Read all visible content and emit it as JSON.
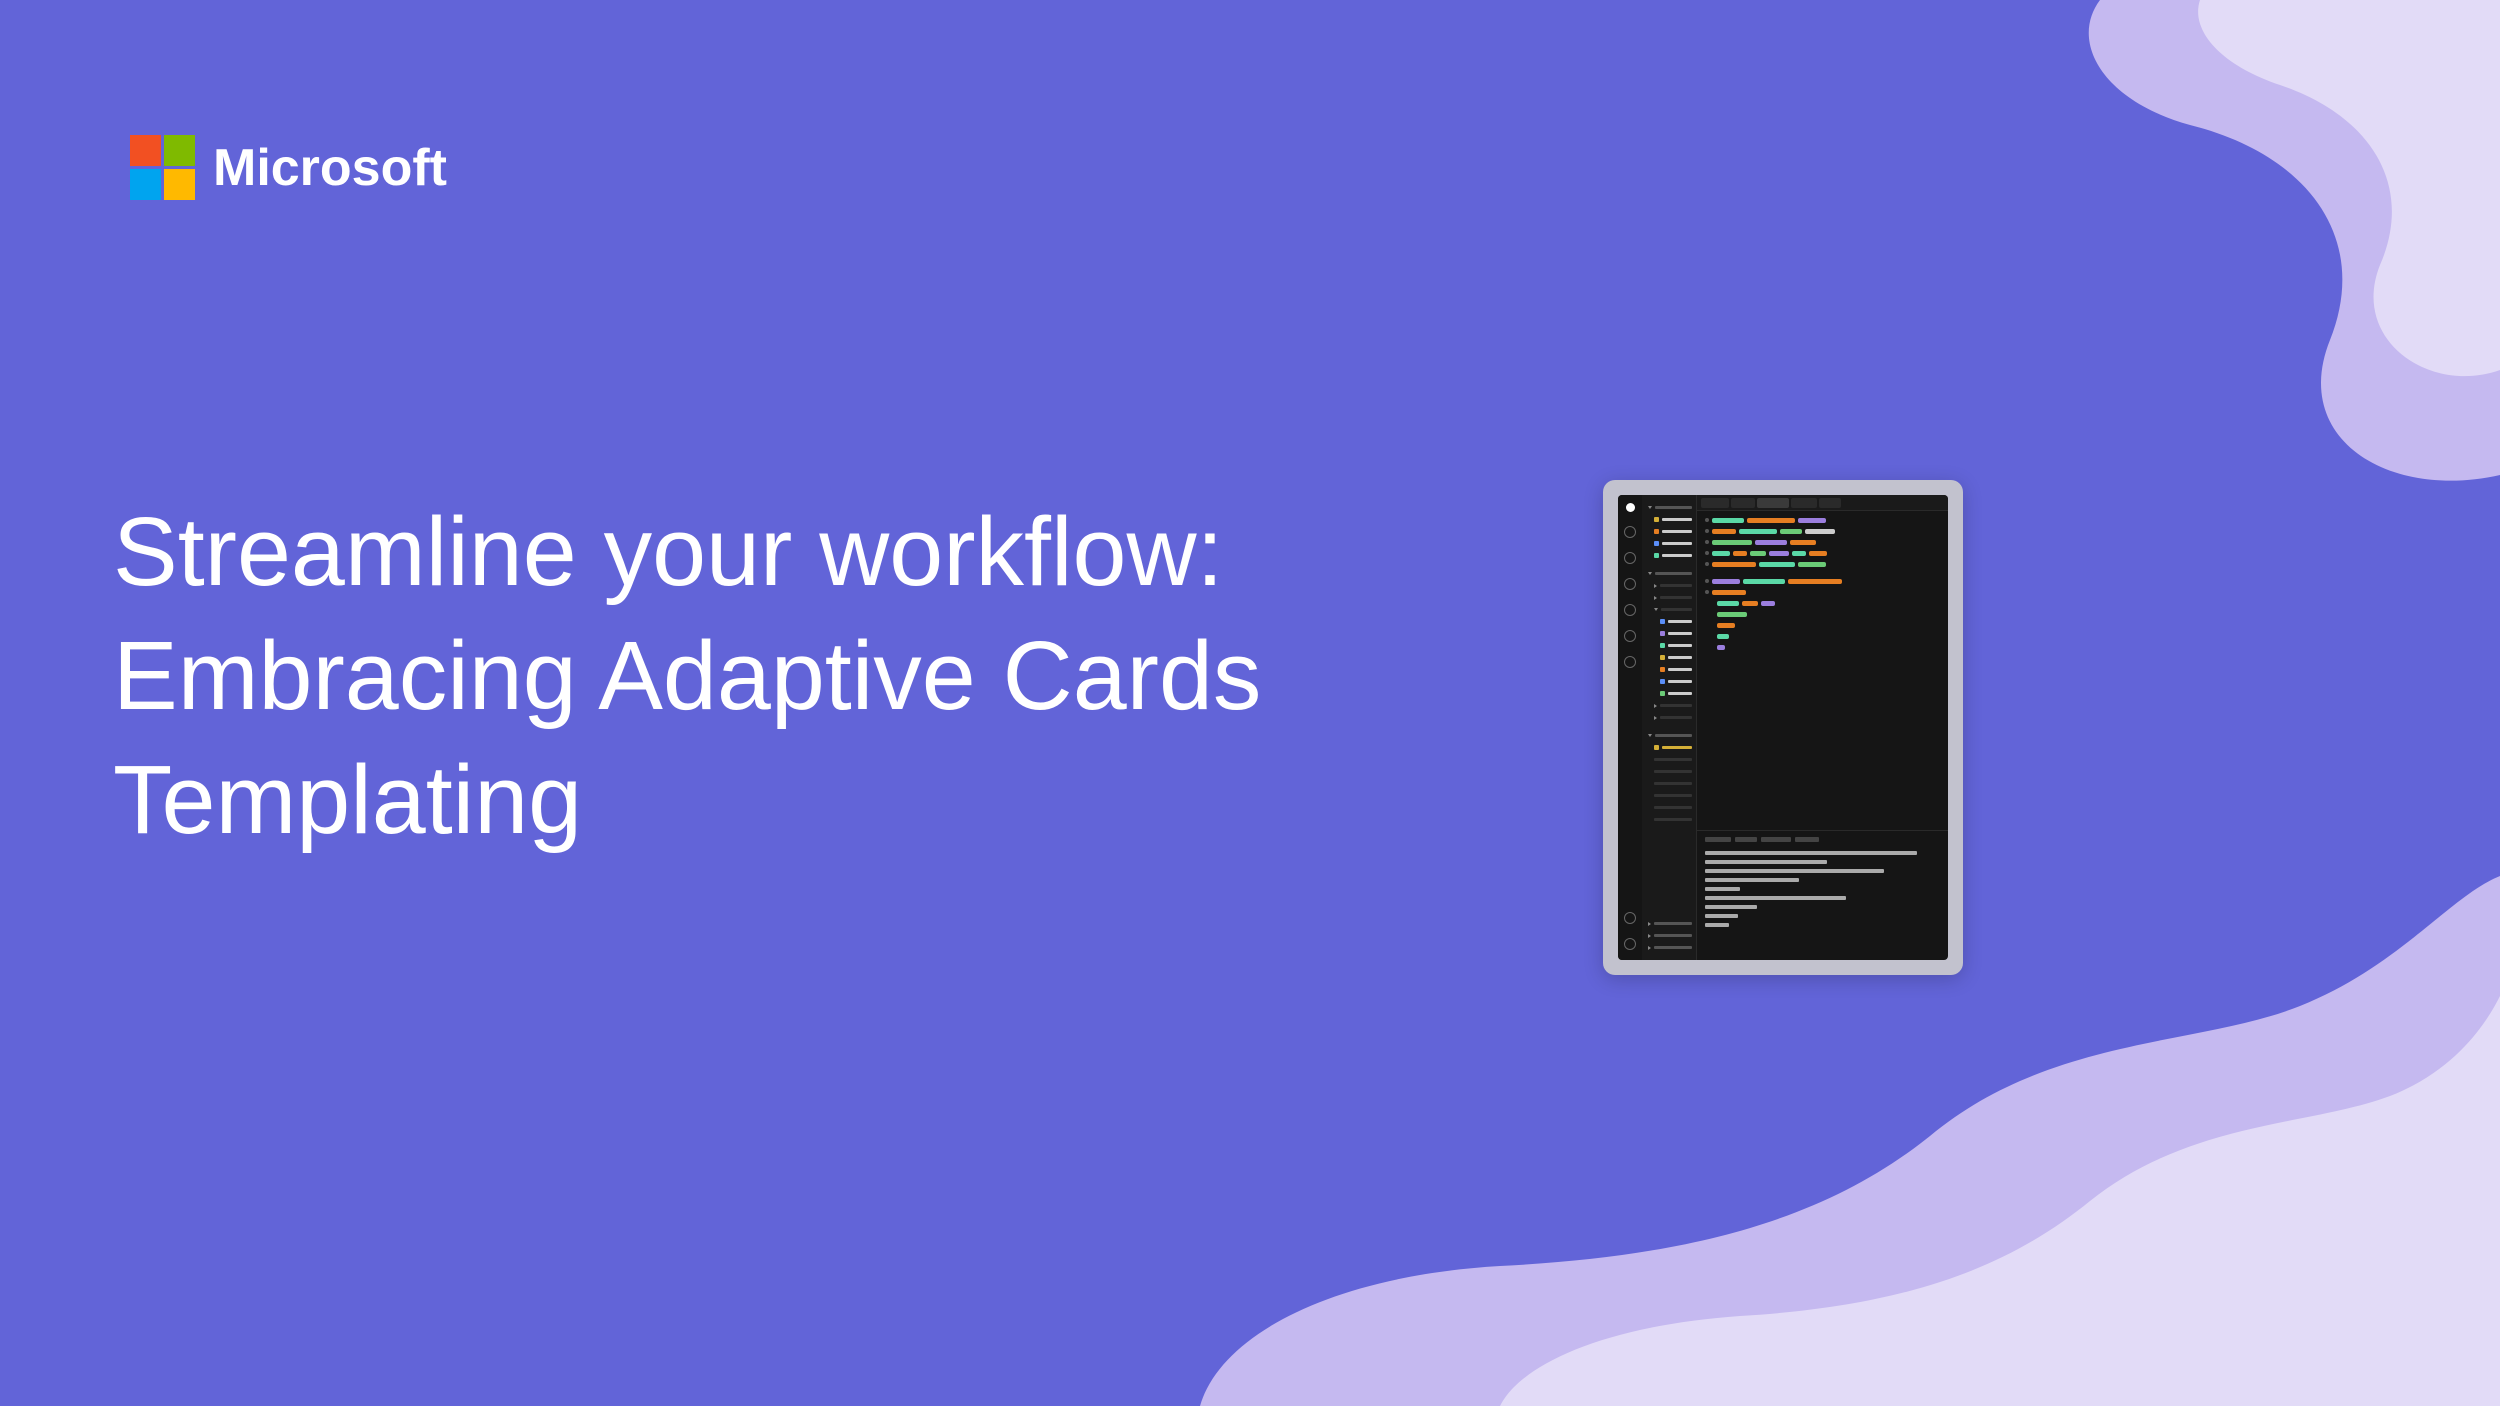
{
  "brand": {
    "name": "Microsoft"
  },
  "title": "Streamline your workflow: Embracing Adaptive Cards Templating",
  "colors": {
    "background": "#6264D8",
    "accent_light": "#C5B9F0",
    "logo_red": "#F25022",
    "logo_green": "#7FBA00",
    "logo_blue": "#00A4EF",
    "logo_yellow": "#FFB900"
  }
}
